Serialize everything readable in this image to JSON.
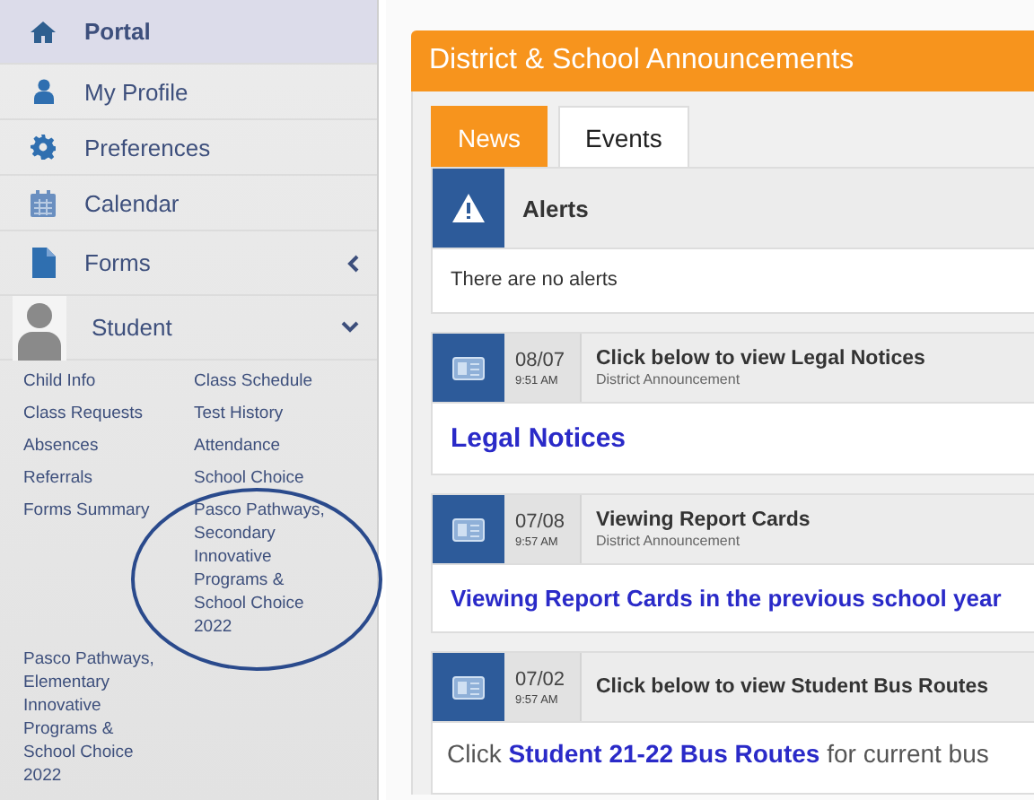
{
  "sidebar": {
    "items": [
      {
        "label": "Portal",
        "selected": true
      },
      {
        "label": "My Profile",
        "selected": false
      },
      {
        "label": "Preferences",
        "selected": false
      },
      {
        "label": "Calendar",
        "selected": false
      },
      {
        "label": "Forms",
        "selected": false,
        "expanded": false
      },
      {
        "label": "Student",
        "selected": false,
        "expanded": true
      }
    ],
    "student_links": [
      {
        "label": "Child Info",
        "circled": false
      },
      {
        "label": "Class Schedule",
        "circled": false
      },
      {
        "label": "Class Requests",
        "circled": false
      },
      {
        "label": "Test History",
        "circled": false
      },
      {
        "label": "Absences",
        "circled": false
      },
      {
        "label": "Attendance",
        "circled": false
      },
      {
        "label": "Referrals",
        "circled": false
      },
      {
        "label": "School Choice",
        "circled": false
      },
      {
        "label": "Forms Summary",
        "circled": false
      },
      {
        "label": "Pasco Pathways, Secondary Innovative Programs & School Choice 2022",
        "circled": true
      },
      {
        "label": "Pasco Pathways, Elementary Innovative Programs & School Choice 2022",
        "circled": false
      }
    ]
  },
  "announcements_panel": {
    "title": "District & School Announcements",
    "tabs": [
      {
        "label": "News",
        "selected": true
      },
      {
        "label": "Events",
        "selected": false
      }
    ],
    "alerts": {
      "title": "Alerts",
      "message": "There are no alerts"
    },
    "announcements": [
      {
        "date": "08/07",
        "time": "9:51 AM",
        "title": "Click below to view Legal Notices",
        "source": "District Announcement",
        "body": {
          "kind": "title-link",
          "parts": [
            {
              "kind": "link",
              "text": "Legal Notices"
            }
          ]
        }
      },
      {
        "date": "07/08",
        "time": "9:57 AM",
        "title": "Viewing Report Cards",
        "source": "District Announcement",
        "body": {
          "kind": "link-line",
          "parts": [
            {
              "kind": "link",
              "text": "Viewing Report Cards in the previous school year"
            }
          ]
        }
      },
      {
        "date": "07/02",
        "time": "9:57 AM",
        "title": "Click below to view Student Bus Routes",
        "body": {
          "kind": "sentence",
          "parts": [
            {
              "kind": "text",
              "text": "Click "
            },
            {
              "kind": "link",
              "text": "Student 21-22 Bus Routes"
            },
            {
              "kind": "text",
              "text": " for current bus"
            }
          ]
        }
      }
    ]
  }
}
